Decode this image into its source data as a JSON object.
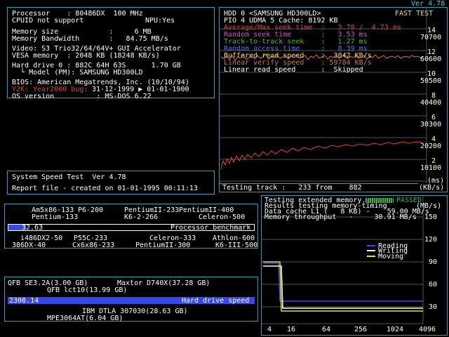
{
  "version": "Ver 4.78",
  "sysinfo": {
    "l1": "Processor    : 80486DX  100 MHz",
    "l2": "CPUID not support",
    "l2b": "NPU:Yes",
    "l3": "Memory size            :     6 MB",
    "l4": "Memory Bandwidth       :   84.75 MB/s",
    "l5": "Video: S3 Trio32/64/64V+ GUI Accelerator",
    "l6": "VESA memory  : 2048 KB (18248 KB/s)",
    "l7": "Hard drive 0 : 882C 64H 63S      1.70 GB",
    "l8": "  └ Model (PM): SAMSUNG HD300LD",
    "l9": "BIOS: American Megatrends, Inc. (10/10/94)",
    "l10a": "Y2K: Year2000 bug:",
    "l10b": " 31-12-1999 ▶ 01-01-1900",
    "l11": "OS version          : MS-DOS 6.22"
  },
  "speed": {
    "l1": "System Speed Test  Ver 4.78",
    "l2": "Report file - created on 01-01-1995 00:11:13"
  },
  "hdd": {
    "title": "HDD 0 <SAMSUNG HD300LD>",
    "fast": "FAST TEST",
    "pio": "PIO 4 UDMA 5 Cache: 8192 KB",
    "r1": "Average/Max seek time  :   3.78 /  4.73 ms",
    "r2": "Random seek time       :   3.53 ms",
    "r3": "Track-to-track seek    :   1.27 ms",
    "r4": "Random access time     :   8.39 ms",
    "r5": "Buffered read speed    :  3042 KB/s",
    "r6": "Linear verify speed    : 59784 KB/s",
    "r7": "Linear read speed      :  Skipped",
    "ms_ticks": [
      "14",
      "12",
      "10",
      "8",
      "6",
      "4",
      "2"
    ],
    "kb_ticks": [
      "70700",
      "60600",
      "50500",
      "40400",
      "30300",
      "20200",
      "10100"
    ],
    "unit_ms": "(ms)",
    "unit_kbs": "(KB/s)",
    "testing": "Testing track :   233 from    882",
    "colors": {
      "avg": "#e04040",
      "rand": "#d050d0",
      "track": "#30c030",
      "access": "#5070ff",
      "buf": "#e8e040",
      "verify": "#d07050"
    }
  },
  "cpu": {
    "top_labels": [
      "Am5x86-133",
      "P6-200",
      "PentiumII-233",
      "PentiumII-400",
      "Pentium-133",
      "K6-2-266",
      "Celeron-500"
    ],
    "value": "32.63",
    "bench_label": "Processor benchmark",
    "bottom_labels": [
      "i486DX2-50",
      "P55C-233",
      "Celeron-333",
      "Athlon-600",
      "386DX-40",
      "Cx6x86-233",
      "PentiumII-300",
      "K6-III-500"
    ],
    "level": 0.07
  },
  "disk": {
    "top_labels": [
      "QFB SE3.2A(3.00 GB)",
      "Maxtor D740X(37.28 GB)",
      "QFB lct10(13.99 GB)"
    ],
    "value": "2308.14",
    "bench_label": "Hard drive speed",
    "bottom_labels": [
      "IBM DTLA 307030(28.63 GB)",
      "MPE3064AT(6.04 GB)"
    ]
  },
  "memory": {
    "l1": "Testing extended memory...",
    "passed": "PASSED",
    "l2": "Results testing memory-timing",
    "l2u": "(MB/s)",
    "l3": "Data cache L1 (   8 KB) -    59.00 MB/s",
    "l4": "Memory throughput   -     30.91 MB/s",
    "legend": [
      "Reading",
      "Writing",
      "Moving"
    ],
    "y_ticks": [
      "150",
      "120",
      "90",
      "60",
      "30"
    ],
    "x_ticks": [
      "4",
      "16",
      "64",
      "256",
      "1024",
      "4096"
    ]
  }
}
